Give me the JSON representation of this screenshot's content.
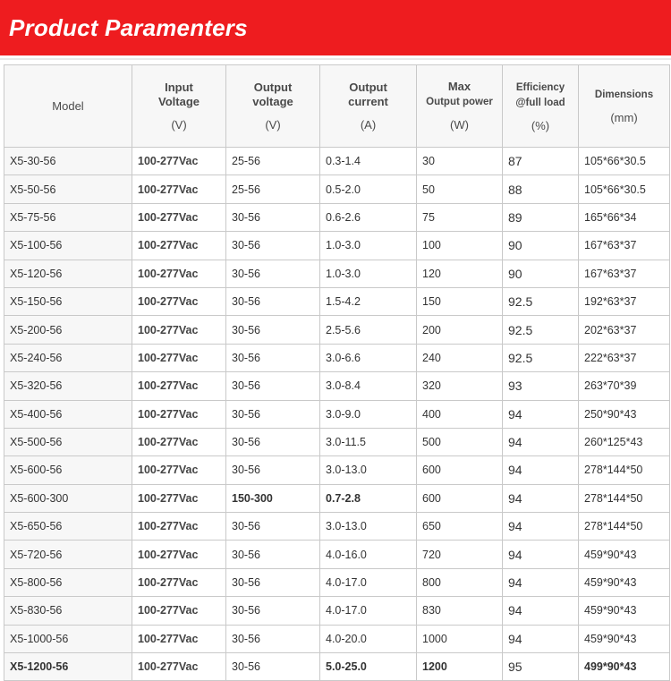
{
  "banner": {
    "title": "Product Paramenters"
  },
  "headers": {
    "model": "Model",
    "input_l1": "Input",
    "input_l2": "Voltage",
    "input_unit": "(V)",
    "outv_l1": "Output",
    "outv_l2": "voltage",
    "outv_unit": "(V)",
    "outc_l1": "Output",
    "outc_l2": "current",
    "outc_unit": "(A)",
    "power_l1": "Max",
    "power_l2": "Output power",
    "power_unit": "(W)",
    "eff_l1": "Efficiency",
    "eff_l2": "@full load",
    "eff_unit": "(%)",
    "dim_l1": "Dimensions",
    "dim_unit": "(mm)"
  },
  "rows": [
    [
      "X5-30-56",
      "100-277Vac",
      "25-56",
      "0.3-1.4",
      "30",
      "87",
      "105*66*30.5"
    ],
    [
      "X5-50-56",
      "100-277Vac",
      "25-56",
      "0.5-2.0",
      "50",
      "88",
      "105*66*30.5"
    ],
    [
      "X5-75-56",
      "100-277Vac",
      "30-56",
      "0.6-2.6",
      "75",
      "89",
      "165*66*34"
    ],
    [
      "X5-100-56",
      "100-277Vac",
      "30-56",
      "1.0-3.0",
      "100",
      "90",
      "167*63*37"
    ],
    [
      "X5-120-56",
      "100-277Vac",
      "30-56",
      "1.0-3.0",
      "120",
      "90",
      "167*63*37"
    ],
    [
      "X5-150-56",
      "100-277Vac",
      "30-56",
      "1.5-4.2",
      "150",
      "92.5",
      "192*63*37"
    ],
    [
      "X5-200-56",
      "100-277Vac",
      "30-56",
      "2.5-5.6",
      "200",
      "92.5",
      "202*63*37"
    ],
    [
      "X5-240-56",
      "100-277Vac",
      "30-56",
      "3.0-6.6",
      "240",
      "92.5",
      "222*63*37"
    ],
    [
      "X5-320-56",
      "100-277Vac",
      "30-56",
      "3.0-8.4",
      "320",
      "93",
      "263*70*39"
    ],
    [
      "X5-400-56",
      "100-277Vac",
      "30-56",
      "3.0-9.0",
      "400",
      "94",
      "250*90*43"
    ],
    [
      "X5-500-56",
      "100-277Vac",
      "30-56",
      "3.0-11.5",
      "500",
      "94",
      "260*125*43"
    ],
    [
      "X5-600-56",
      "100-277Vac",
      "30-56",
      "3.0-13.0",
      "600",
      "94",
      "278*144*50"
    ],
    [
      "X5-600-300",
      "100-277Vac",
      "150-300",
      "0.7-2.8",
      "600",
      "94",
      "278*144*50"
    ],
    [
      "X5-650-56",
      "100-277Vac",
      "30-56",
      "3.0-13.0",
      "650",
      "94",
      "278*144*50"
    ],
    [
      "X5-720-56",
      "100-277Vac",
      "30-56",
      "4.0-16.0",
      "720",
      "94",
      "459*90*43"
    ],
    [
      "X5-800-56",
      "100-277Vac",
      "30-56",
      "4.0-17.0",
      "800",
      "94",
      "459*90*43"
    ],
    [
      "X5-830-56",
      "100-277Vac",
      "30-56",
      "4.0-17.0",
      "830",
      "94",
      "459*90*43"
    ],
    [
      "X5-1000-56",
      "100-277Vac",
      "30-56",
      "4.0-20.0",
      "1000",
      "94",
      "459*90*43"
    ],
    [
      "X5-1200-56",
      "100-277Vac",
      "30-56",
      "5.0-25.0",
      "1200",
      "95",
      "499*90*43"
    ]
  ]
}
